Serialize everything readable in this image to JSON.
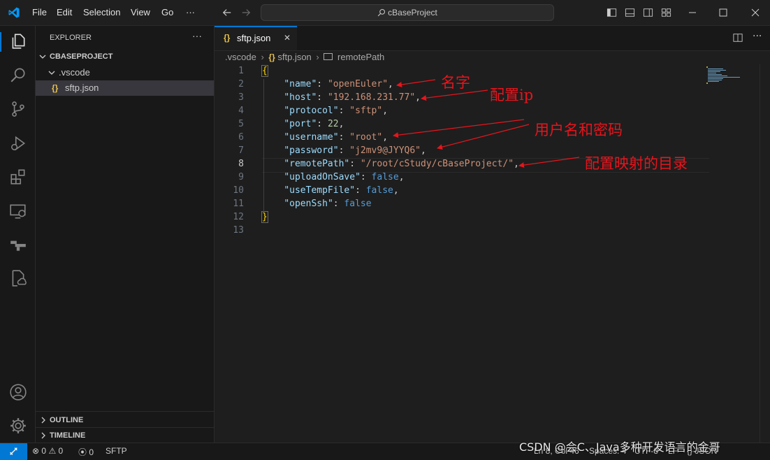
{
  "titlebar": {
    "menu": [
      "File",
      "Edit",
      "Selection",
      "View",
      "Go"
    ],
    "more": "···",
    "search_text": "cBaseProject"
  },
  "sidebar": {
    "header": "EXPLORER",
    "more": "···",
    "project": "CBASEPROJECT",
    "folder": ".vscode",
    "file": "sftp.json",
    "outline": "OUTLINE",
    "timeline": "TIMELINE"
  },
  "tab": {
    "label": "sftp.json",
    "close": "✕"
  },
  "breadcrumb": {
    "part1": ".vscode",
    "part2": "sftp.json",
    "part3": "remotePath"
  },
  "editor": {
    "line_numbers": [
      "1",
      "2",
      "3",
      "4",
      "5",
      "6",
      "7",
      "8",
      "9",
      "10",
      "11",
      "12",
      "13"
    ],
    "lines": [
      {
        "key": "name",
        "value": "\"openEuler\"",
        "type": "string",
        "comma": ","
      },
      {
        "key": "host",
        "value": "\"192.168.231.77\"",
        "type": "string",
        "comma": ","
      },
      {
        "key": "protocol",
        "value": "\"sftp\"",
        "type": "string",
        "comma": ","
      },
      {
        "key": "port",
        "value": "22",
        "type": "number",
        "comma": ","
      },
      {
        "key": "username",
        "value": "\"root\"",
        "type": "string",
        "comma": ","
      },
      {
        "key": "password",
        "value": "\"j2mv9@JYYQ6\"",
        "type": "string",
        "comma": ","
      },
      {
        "key": "remotePath",
        "value": "\"/root/cStudy/cBaseProject/\"",
        "type": "string",
        "comma": ","
      },
      {
        "key": "uploadOnSave",
        "value": "false",
        "type": "bool",
        "comma": ","
      },
      {
        "key": "useTempFile",
        "value": "false",
        "type": "bool",
        "comma": ","
      },
      {
        "key": "openSsh",
        "value": "false",
        "type": "bool",
        "comma": ""
      }
    ],
    "open_brace": "{",
    "close_brace": "}"
  },
  "annotations": {
    "name": "名字",
    "ip": "配置ip",
    "credentials": "用户名和密码",
    "mapping": "配置映射的目录"
  },
  "status": {
    "errors": "0",
    "warnings": "0",
    "ports": "0",
    "sftp": "SFTP",
    "position": "Ln 8, Col 46",
    "spaces": "Spaces: 4",
    "encoding": "UTF-8",
    "eol": "LF",
    "language": "{} JSON"
  },
  "watermark": "CSDN @会C、Java多种开发语言的金哥",
  "colors": {
    "accent": "#0078d4",
    "annotation": "#e8141c",
    "json_key": "#9cdcfe",
    "json_string": "#ce9178"
  }
}
